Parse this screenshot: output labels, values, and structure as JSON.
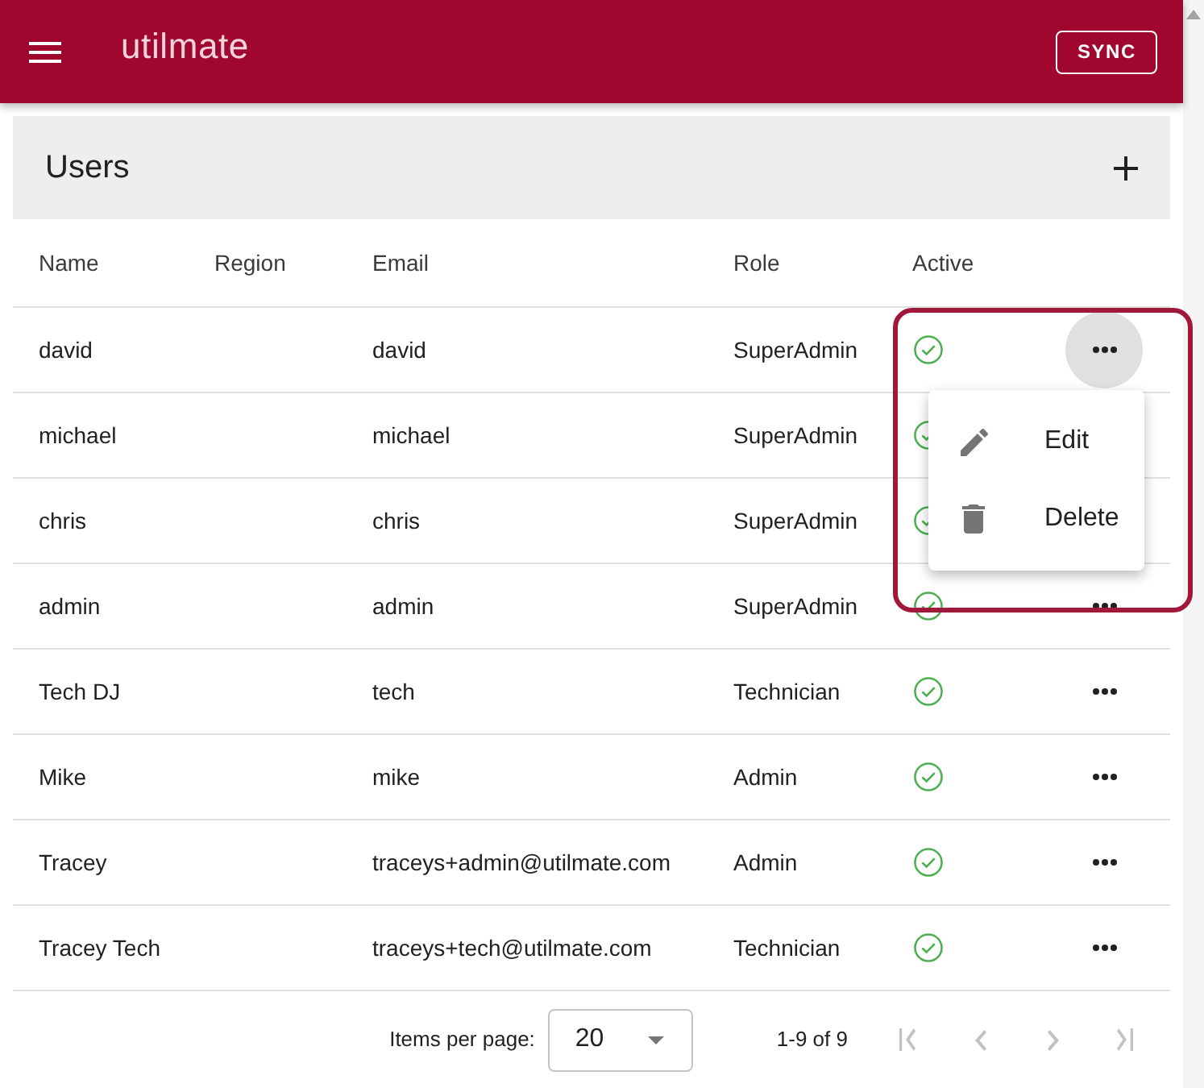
{
  "app_bar": {
    "logo": "utilmate",
    "sync_button": "SYNC"
  },
  "panel": {
    "title": "Users"
  },
  "table": {
    "columns": [
      "Name",
      "Region",
      "Email",
      "Role",
      "Active"
    ],
    "rows": [
      {
        "name": "david",
        "email": "david",
        "role": "SuperAdmin",
        "active": true,
        "menu_open": true
      },
      {
        "name": "michael",
        "email": "michael",
        "role": "SuperAdmin",
        "active": true,
        "menu_open": false
      },
      {
        "name": "chris",
        "email": "chris",
        "role": "SuperAdmin",
        "active": true,
        "menu_open": false
      },
      {
        "name": "admin",
        "email": "admin",
        "role": "SuperAdmin",
        "active": true,
        "menu_open": false
      },
      {
        "name": "Tech DJ",
        "email": "tech",
        "role": "Technician",
        "active": true,
        "menu_open": false
      },
      {
        "name": "Mike",
        "email": "mike",
        "role": "Admin",
        "active": true,
        "menu_open": false
      },
      {
        "name": "Tracey",
        "email": "traceys+admin@utilmate.com",
        "role": "Admin",
        "active": true,
        "menu_open": false
      },
      {
        "name": "Tracey Tech",
        "email": "traceys+tech@utilmate.com",
        "role": "Technician",
        "active": true,
        "menu_open": false
      }
    ]
  },
  "row_menu": {
    "items": [
      {
        "kind": "edit",
        "label": "Edit"
      },
      {
        "kind": "delete",
        "label": "Delete"
      }
    ]
  },
  "paginator": {
    "label": "Items per page:",
    "page_size": "20",
    "range": "1-9 of 9",
    "nav_buttons": [
      {
        "kind": "first",
        "disabled": true
      },
      {
        "kind": "previous",
        "disabled": true
      },
      {
        "kind": "next",
        "disabled": true
      },
      {
        "kind": "last",
        "disabled": true
      }
    ]
  },
  "highlight_frame": true
}
